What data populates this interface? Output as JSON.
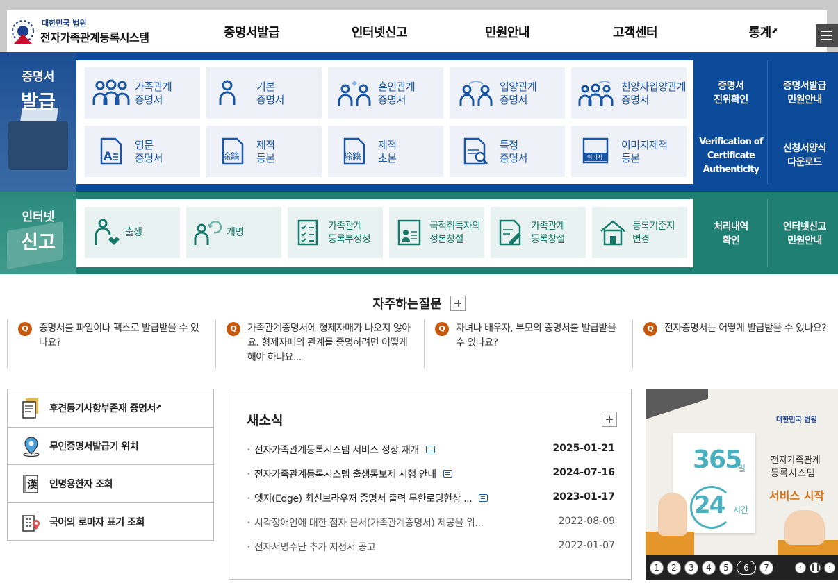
{
  "header": {
    "court": "대한민국 법원",
    "system": "전자가족관계등록시스템",
    "nav": [
      "증명서발급",
      "인터넷신고",
      "민원안내",
      "고객센터",
      "통계"
    ],
    "nav_external_icon": "external-link-icon",
    "menu_icon": "hamburger-icon"
  },
  "cert": {
    "title_top": "증명서",
    "title_bottom": "발급",
    "items": [
      {
        "l1": "가족관계",
        "l2": "증명서",
        "icon": "family-icon"
      },
      {
        "l1": "기본",
        "l2": "증명서",
        "icon": "person-icon"
      },
      {
        "l1": "혼인관계",
        "l2": "증명서",
        "icon": "marriage-icon"
      },
      {
        "l1": "입양관계",
        "l2": "증명서",
        "icon": "adoption-icon"
      },
      {
        "l1": "친양자입양관계",
        "l2": "증명서",
        "icon": "full-adoption-icon"
      },
      {
        "l1": "영문",
        "l2": "증명서",
        "icon": "english-doc-icon"
      },
      {
        "l1": "제적",
        "l2": "등본",
        "icon": "removed-register-copy-icon"
      },
      {
        "l1": "제적",
        "l2": "초본",
        "icon": "removed-register-extract-icon"
      },
      {
        "l1": "특정",
        "l2": "증명서",
        "icon": "search-doc-icon"
      },
      {
        "l1": "이미지제적",
        "l2": "등본",
        "icon": "image-register-icon"
      }
    ],
    "icon_text_removed": "除籍",
    "icon_text_image": "이미지",
    "side": [
      {
        "l1": "증명서",
        "l2": "진위확인"
      },
      {
        "l1": "증명서발급",
        "l2": "민원안내"
      },
      {
        "l1": "Verification of",
        "l2": "Certificate",
        "l3": "Authenticity"
      },
      {
        "l1": "신청서양식",
        "l2": "다운로드"
      }
    ],
    "color": "#0b4b9a"
  },
  "report": {
    "title_top": "인터넷",
    "title_bottom": "신고",
    "items": [
      {
        "l1": "출생",
        "l2": "",
        "icon": "birth-icon"
      },
      {
        "l1": "개명",
        "l2": "",
        "icon": "rename-icon"
      },
      {
        "l1": "가족관계",
        "l2": "등록부정정",
        "icon": "checklist-icon"
      },
      {
        "l1": "국적취득자의",
        "l2": "성본창설",
        "icon": "id-card-icon"
      },
      {
        "l1": "가족관계",
        "l2": "등록창설",
        "icon": "edit-doc-icon"
      },
      {
        "l1": "등록기준지",
        "l2": "변경",
        "icon": "house-icon"
      }
    ],
    "side": [
      {
        "l1": "처리내역",
        "l2": "확인"
      },
      {
        "l1": "인터넷신고",
        "l2": "민원안내"
      }
    ],
    "color": "#1f7f73"
  },
  "faq": {
    "title": "자주하는질문",
    "q_mark": "Q",
    "items": [
      "증명서를 파일이나 팩스로 발급받을 수 있나요?",
      "가족관계증명서에 형제자매가 나오지 않아요. 형제자매의 관계를 증명하려면 어떻게 해야 하나요...",
      "자녀나 배우자, 부모의 증명서를 발급받을 수 있나요?",
      "전자증명서는 어떻게 발급받을 수 있나요?"
    ]
  },
  "quick": [
    {
      "label": "후견등기사항부존재 증명서",
      "icon": "document-icon",
      "external": true
    },
    {
      "label": "무인증명서발급기 위치",
      "icon": "location-pin-icon",
      "external": false
    },
    {
      "label": "인명용한자 조회",
      "icon": "hanja-book-icon",
      "external": false
    },
    {
      "label": "국어의 로마자 표기 조회",
      "icon": "building-pin-icon",
      "external": false
    }
  ],
  "quick_hanja_glyph": "漢",
  "news": {
    "title": "새소식",
    "items": [
      {
        "title": "전자가족관계등록시스템 서비스 정상 재개",
        "date": "2025-01-21",
        "bold": true,
        "memo": true
      },
      {
        "title": "전자가족관계등록시스템 출생통보제 시행 안내",
        "date": "2024-07-16",
        "bold": true,
        "memo": true
      },
      {
        "title": "엣지(Edge) 최신브라우저 증명서 출력 무한로딩현상 ...",
        "date": "2023-01-17",
        "bold": true,
        "memo": true
      },
      {
        "title": "시각장애인에 대한 점자 문서(가족관계증명서) 제공을 위...",
        "date": "2022-08-09",
        "bold": false,
        "memo": false
      },
      {
        "title": "전자서명수단 추가 지정서 공고",
        "date": "2022-01-07",
        "bold": false,
        "memo": false
      }
    ]
  },
  "banner": {
    "court": "대한민국 법원",
    "n365": "365",
    "il": "일",
    "n24": "24",
    "si": "시간",
    "sys1": "전자가족관계",
    "sys2": "등록시스템",
    "start": "서비스 시작",
    "pages": [
      "1",
      "2",
      "3",
      "4",
      "5",
      "6",
      "7"
    ],
    "active_page": "6",
    "prev_icon": "chevron-left-icon",
    "pause_icon": "pause-icon",
    "next_icon": "chevron-right-icon",
    "prev_glyph": "‹",
    "pause_glyph": "❚❚",
    "next_glyph": "›"
  }
}
